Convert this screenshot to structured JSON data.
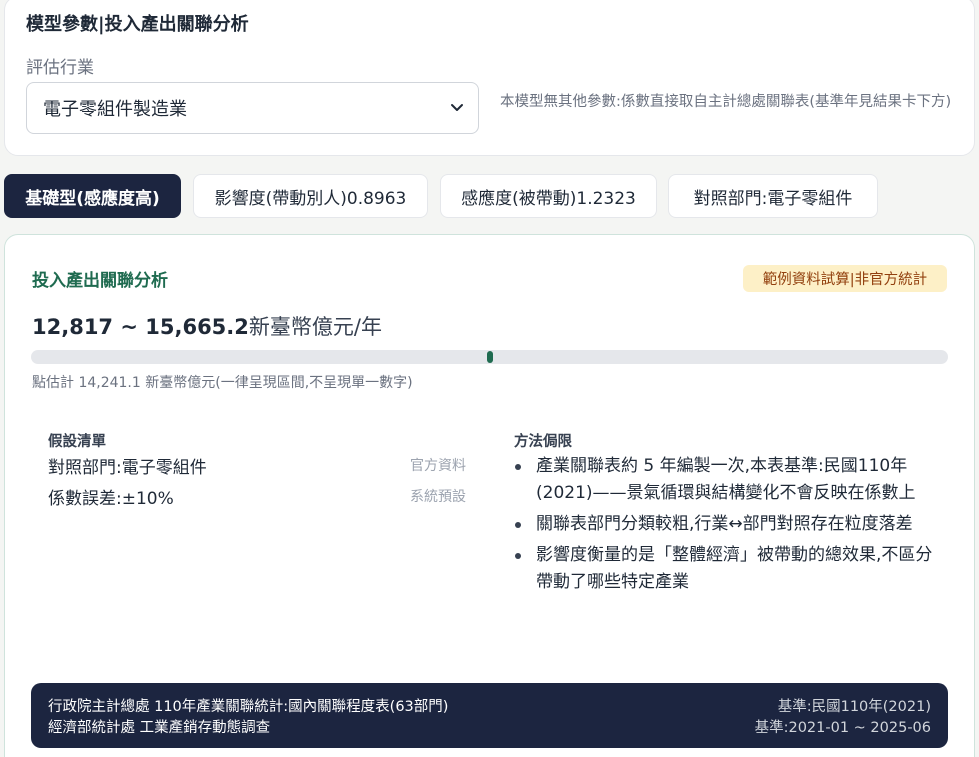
{
  "header": {
    "title": "模型參數|投入產出關聯分析",
    "industry_label": "評估行業",
    "industry_selected": "電子零組件製造業",
    "note": "本模型無其他參數:係數直接取自主計總處關聯表(基準年見結果卡下方)"
  },
  "tabs": [
    {
      "label": "基礎型(感應度高)",
      "active": true
    },
    {
      "label": "影響度(帶動別人)0.8963",
      "active": false
    },
    {
      "label": "感應度(被帶動)1.2323",
      "active": false
    },
    {
      "label": "對照部門:電子零組件",
      "active": false
    }
  ],
  "result": {
    "title": "投入產出關聯分析",
    "badge": "範例資料試算|非官方統計",
    "range_text": "12,817 ~ 15,665.2",
    "unit": "新臺幣億元/年",
    "range_low": 12817,
    "range_high": 15665.2,
    "point_estimate_value": 14241.1,
    "point_estimate_text": "點估計 14,241.1 新臺幣億元(一律呈現區間,不呈現單一數字)"
  },
  "assumptions": {
    "title": "假設清單",
    "items": [
      {
        "text": "對照部門:電子零組件",
        "source": "官方資料"
      },
      {
        "text": "係數誤差:±10%",
        "source": "系統預設"
      }
    ]
  },
  "limitations": {
    "title": "方法侷限",
    "items": [
      "產業關聯表約 5 年編製一次,本表基準:民國110年(2021)——景氣循環與結構變化不會反映在係數上",
      "關聯表部門分類較粗,行業↔部門對照存在粒度落差",
      "影響度衡量的是「整體經濟」被帶動的總效果,不區分帶動了哪些特定產業"
    ]
  },
  "footer": {
    "source1": "行政院主計總處 110年產業關聯統計:國內關聯程度表(63部門)",
    "source2": "經濟部統計處 工業產銷存動態調查",
    "base1": "基準:民國110年(2021)",
    "base2": "基準:2021-01 ~ 2025-06"
  },
  "colors": {
    "navy": "#1c2540",
    "green": "#1f6b50",
    "badge_bg": "#fdf0c7"
  }
}
